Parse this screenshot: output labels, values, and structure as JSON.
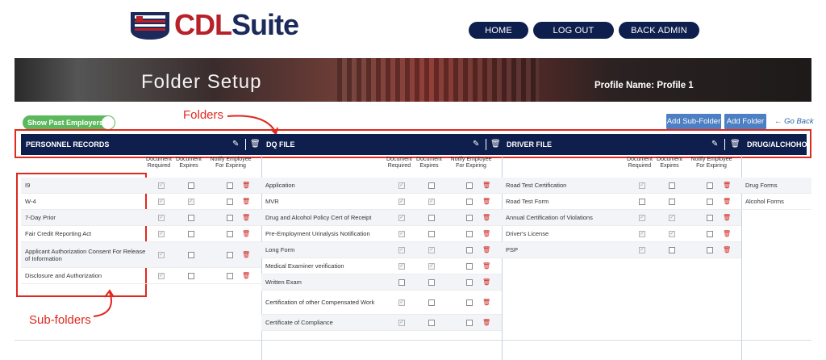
{
  "brand": {
    "name_part1": "CDL",
    "name_part2": "Suite",
    "red": "#b8202a",
    "navy": "#1c2a5b"
  },
  "nav": {
    "home": "HOME",
    "logout": "LOG OUT",
    "back_admin": "BACK ADMIN"
  },
  "banner": {
    "title": "Folder Setup",
    "profile": "Profile Name: Profile 1"
  },
  "toolbar": {
    "show_past_employers": "Show Past Employers",
    "add_subfolder": "Add Sub-Folder",
    "add_folder": "Add Folder",
    "go_back": "Go Back"
  },
  "annotations": {
    "folders": "Folders",
    "subfolders": "Sub-folders"
  },
  "column_headers": {
    "doc_required": "Document Required",
    "doc_expires": "Document Expires",
    "notify": "Notify Employee For Expiring"
  },
  "folders": [
    {
      "title": "PERSONNEL RECORDS",
      "rows": [
        {
          "label": "I9",
          "req": true,
          "exp": false,
          "notify": false
        },
        {
          "label": "W-4",
          "req": true,
          "exp": true,
          "notify": false
        },
        {
          "label": "7-Day Prior",
          "req": true,
          "exp": false,
          "notify": false
        },
        {
          "label": "Fair Credit Reporting Act",
          "req": true,
          "exp": false,
          "notify": false
        },
        {
          "label": "Applicant Authorization Consent For Release of Information",
          "req": true,
          "exp": false,
          "notify": false
        },
        {
          "label": "Disclosure and Authorization",
          "req": true,
          "exp": false,
          "notify": false
        }
      ]
    },
    {
      "title": "DQ FILE",
      "rows": [
        {
          "label": "Application",
          "req": true,
          "exp": false,
          "notify": false
        },
        {
          "label": "MVR",
          "req": true,
          "exp": true,
          "notify": false
        },
        {
          "label": "Drug and Alcohol Policy Cert of Receipt",
          "req": true,
          "exp": false,
          "notify": false
        },
        {
          "label": "Pre-Employment Urinalysis Notification",
          "req": true,
          "exp": false,
          "notify": false
        },
        {
          "label": "Long Form",
          "req": true,
          "exp": true,
          "notify": false
        },
        {
          "label": "Medical Examiner verification",
          "req": true,
          "exp": true,
          "notify": false
        },
        {
          "label": "Written Exam",
          "req": false,
          "exp": false,
          "notify": false
        },
        {
          "label": "Certification of other Compensated Work",
          "req": true,
          "exp": false,
          "notify": false
        },
        {
          "label": "Certificate of Compliance",
          "req": true,
          "exp": false,
          "notify": false
        }
      ]
    },
    {
      "title": "DRIVER FILE",
      "rows": [
        {
          "label": "Road Test Certification",
          "req": true,
          "exp": false,
          "notify": false
        },
        {
          "label": "Road Test Form",
          "req": false,
          "exp": false,
          "notify": false
        },
        {
          "label": "Annual Certification of Violations",
          "req": true,
          "exp": true,
          "notify": false
        },
        {
          "label": "Driver's License",
          "req": true,
          "exp": true,
          "notify": false
        },
        {
          "label": "PSP",
          "req": true,
          "exp": false,
          "notify": false
        }
      ]
    },
    {
      "title": "DRUG/ALCHOHOL",
      "rows": [
        {
          "label": "Drug Forms"
        },
        {
          "label": "Alcohol Forms"
        }
      ]
    }
  ],
  "colors": {
    "header_bg": "#0f1f4d",
    "accent_blue": "#4d7fc4",
    "toggle_green": "#5cb85c",
    "annotation_red": "#e0281e"
  },
  "icons": [
    "pencil-icon",
    "trash-icon",
    "arrow-left-icon"
  ]
}
